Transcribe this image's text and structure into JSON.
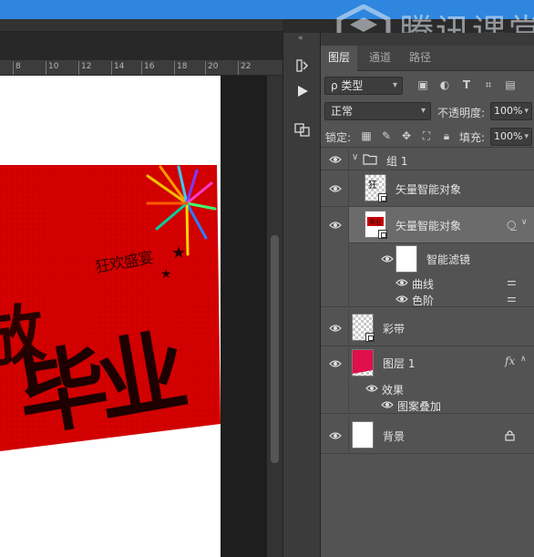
{
  "watermark": {
    "text": "腾讯课堂"
  },
  "ruler": {
    "ticks": [
      "8",
      "10",
      "12",
      "14",
      "16",
      "18",
      "20",
      "22"
    ]
  },
  "artwork": {
    "headline": "毕业",
    "headline_prefix": "放",
    "subtext": "狂欢盛宴"
  },
  "panel": {
    "tabs": [
      {
        "label": "图层",
        "active": true
      },
      {
        "label": "通道",
        "active": false
      },
      {
        "label": "路径",
        "active": false
      }
    ],
    "filter": {
      "value": "ρ 类型"
    },
    "blend_mode": {
      "value": "正常"
    },
    "opacity": {
      "label": "不透明度:",
      "value": "100%"
    },
    "lock": {
      "label": "锁定:"
    },
    "fill": {
      "label": "填充:",
      "value": "100%"
    }
  },
  "layers": {
    "group": {
      "name": "组 1"
    },
    "smart1": {
      "name": "矢量智能对象"
    },
    "smart2": {
      "name": "矢量智能对象"
    },
    "smart_filters": {
      "name": "智能滤镜"
    },
    "filter_curves": {
      "name": "曲线"
    },
    "filter_levels": {
      "name": "色阶"
    },
    "ribbon": {
      "name": "彩带"
    },
    "layer1": {
      "name": "图层 1",
      "fx": "fx"
    },
    "effects": {
      "name": "效果"
    },
    "pattern_overlay": {
      "name": "图案叠加"
    },
    "background": {
      "name": "背景"
    }
  },
  "colors": {
    "accent_blue": "#2e86de",
    "artwork_red": "#d20000",
    "layer1_red": "#e0104c",
    "selected_row": "#6b6b6b"
  }
}
